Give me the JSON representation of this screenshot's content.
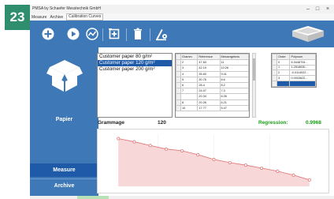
{
  "page_number": "23",
  "window": {
    "title": "PMSA by Schaefer Messtechnik GmbH",
    "controls": {
      "minimize": "–",
      "maximize": "□",
      "close": "×"
    }
  },
  "menubar": {
    "items": [
      "Measure",
      "Archive",
      "Calibration Curves"
    ]
  },
  "toolbar": {
    "icons": [
      "add-circle-icon",
      "play-circle-icon",
      "trend-circle-icon",
      "add-square-icon",
      "trash-icon",
      "calibrate-icon",
      "scanner-device-icon"
    ],
    "accent_color": "#3f78b7"
  },
  "sidebar": {
    "category_label": "Papier",
    "measure_label": "Measure",
    "archive_label": "Archive",
    "active_color": "#1f5aa8"
  },
  "paper_list": {
    "items": [
      "Customer paper 80 g/m²",
      "Customer paper 120 g/m²",
      "Customer paper 200 g/m²"
    ],
    "selected_index": 1
  },
  "calibration_table": {
    "columns": [
      "Gramm",
      "Reference",
      "Messergebnis"
    ],
    "rows": [
      [
        "2",
        "47.63",
        "11"
      ],
      [
        "3",
        "42.19",
        "10.26"
      ],
      [
        "4",
        "35.60",
        "9.41"
      ],
      [
        "5",
        "30.76",
        "8.6"
      ],
      [
        "6",
        "28.4",
        "8.2"
      ],
      [
        "7",
        "24.07",
        "7.3"
      ],
      [
        "",
        "20.34",
        "6.06"
      ],
      [
        "8",
        "20.26",
        "6.21"
      ],
      [
        "10",
        "17.77",
        "5.47"
      ]
    ]
  },
  "coefficient_table": {
    "columns": [
      "Order",
      "Polynom"
    ],
    "rows": [
      [
        "0",
        "6.3448704..."
      ],
      [
        "1",
        "1.2518930..."
      ],
      [
        "2",
        "-0.0114022..."
      ],
      [
        "3",
        "0.0003622..."
      ],
      [
        "",
        ""
      ]
    ],
    "selected_row": 4
  },
  "grammage": {
    "label": "Grammage",
    "value": "120"
  },
  "regression": {
    "label": "Regression:",
    "value": "0.9968",
    "color": "#19a019"
  },
  "chart_data": {
    "type": "line",
    "x_ticks": [
      "",
      "",
      ""
    ],
    "series": [
      {
        "x": [
          1,
          2,
          3,
          4,
          5,
          6,
          7,
          8,
          9,
          10,
          11,
          12,
          13
        ],
        "values": [
          11,
          10.26,
          9.41,
          8.6,
          8.2,
          7.3,
          6.21,
          5.47,
          4.9,
          4.2,
          3.5,
          2.6,
          1.5
        ],
        "color": "#e07070",
        "fill": "#f7d7d7"
      }
    ],
    "ylim": [
      0,
      12
    ],
    "xlim": [
      0,
      14
    ]
  },
  "status": {
    "indicator_color": "#b7e1b7"
  }
}
